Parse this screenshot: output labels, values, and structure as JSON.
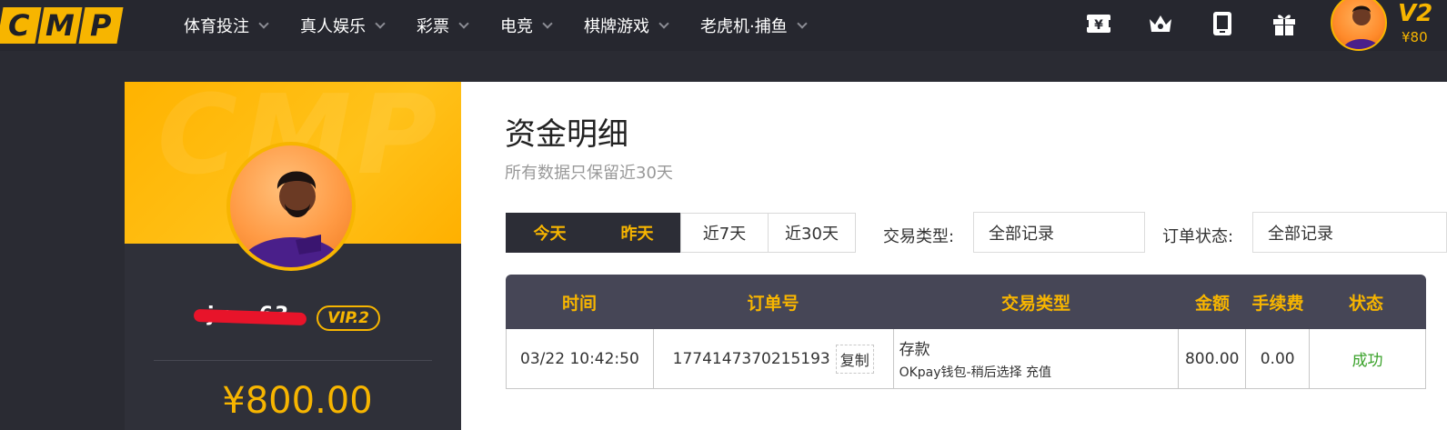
{
  "logo": {
    "letters": [
      "C",
      "M",
      "P"
    ]
  },
  "nav": {
    "items": [
      {
        "label": "体育投注"
      },
      {
        "label": "真人娱乐"
      },
      {
        "label": "彩票"
      },
      {
        "label": "电竞"
      },
      {
        "label": "棋牌游戏"
      },
      {
        "label": "老虎机·捕鱼"
      }
    ]
  },
  "top_icons": [
    "yen-card-icon",
    "crown-icon",
    "tablet-icon",
    "gift-icon"
  ],
  "user": {
    "vip_short": "V2",
    "balance_short": "¥80",
    "vip_badge": "VIP.2",
    "balance": "¥800.00",
    "username": "cjx···63"
  },
  "main": {
    "title": "资金明细",
    "subtitle": "所有数据只保留近30天",
    "ranges": [
      "今天",
      "昨天",
      "近7天",
      "近30天"
    ],
    "trade_type_label": "交易类型:",
    "trade_type_value": "全部记录",
    "order_status_label": "订单状态:",
    "order_status_value": "全部记录"
  },
  "table": {
    "headers": [
      "时间",
      "订单号",
      "交易类型",
      "金额",
      "手续费",
      "状态"
    ],
    "rows": [
      {
        "time": "03/22 10:42:50",
        "order_no": "1774147370215193",
        "copy_label": "复制",
        "type": "存款",
        "type_detail": "OKpay钱包-稍后选择 充值",
        "amount": "800.00",
        "fee": "0.00",
        "status": "成功"
      }
    ]
  },
  "colors": {
    "accent": "#f7b500",
    "dark": "#26272f",
    "success": "#3aa22a"
  }
}
